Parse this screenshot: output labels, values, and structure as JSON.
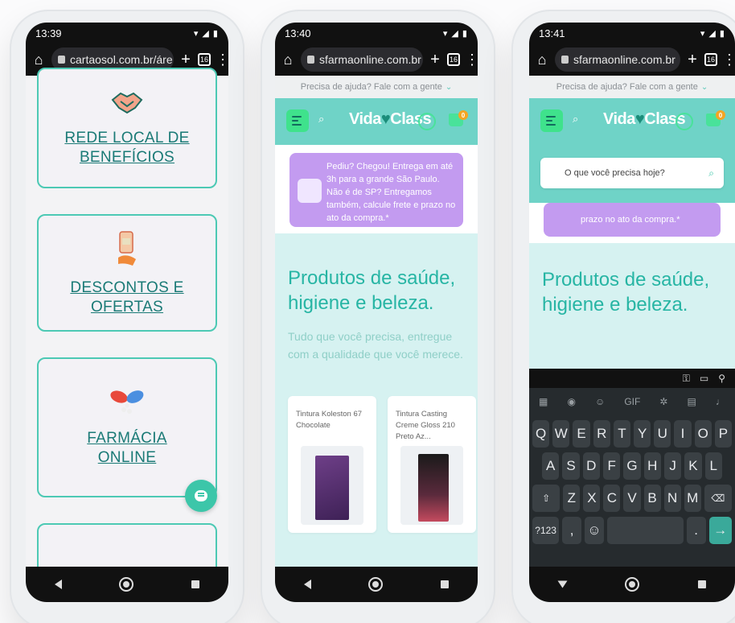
{
  "phones": [
    {
      "status_time": "13:39",
      "url": "cartaosol.com.br/áre",
      "tab_count": "16",
      "cards": [
        {
          "title_line1": "REDE LOCAL DE",
          "title_line2": "BENEFÍCIOS",
          "icon": "handshake-icon"
        },
        {
          "title_line1": "DESCONTOS E OFERTAS",
          "title_line2": "",
          "icon": "price-tag-icon"
        },
        {
          "title_line1": "FARMÁCIA",
          "title_line2": "ONLINE",
          "icon": "pills-icon"
        }
      ]
    },
    {
      "status_time": "13:40",
      "url": "sfarmaonline.com.br",
      "tab_count": "16",
      "help_text": "Precisa de ajuda? Fale com a gente",
      "logo_left": "Vida",
      "logo_right": "Class",
      "cart_count": "0",
      "delivery_text": "Pediu? Chegou! Entrega em até 3h para a grande São Paulo. Não é de SP? Entregamos também, calcule frete e prazo no ato da compra.*",
      "hero_title": "Produtos de saúde, higiene e beleza.",
      "hero_sub": "Tudo que você precisa, entregue com a qualidade que você merece.",
      "products": [
        {
          "name": "Tintura Koleston 67 Chocolate"
        },
        {
          "name": "Tintura Casting Creme Gloss 210 Preto Az..."
        }
      ]
    },
    {
      "status_time": "13:41",
      "url": "sfarmaonline.com.br",
      "tab_count": "16",
      "help_text": "Precisa de ajuda? Fale com a gente",
      "logo_left": "Vida",
      "logo_right": "Class",
      "cart_count": "0",
      "search_placeholder": "O que você precisa hoje?",
      "delivery_tail": "prazo no ato da compra.*",
      "hero_title": "Produtos de saúde, higiene e beleza.",
      "keyboard": {
        "row1": [
          "Q",
          "W",
          "E",
          "R",
          "T",
          "Y",
          "U",
          "I",
          "O",
          "P"
        ],
        "row2": [
          "A",
          "S",
          "D",
          "F",
          "G",
          "H",
          "J",
          "K",
          "L"
        ],
        "row3": [
          "Z",
          "X",
          "C",
          "V",
          "B",
          "N",
          "M"
        ],
        "symbols_key": "?123",
        "comma": ",",
        "period": ".",
        "gif": "GIF"
      }
    }
  ],
  "colors": {
    "teal": "#6fd3c7",
    "green": "#3fe28c",
    "purple": "#c39bf0",
    "hero_text": "#27b5a4"
  }
}
